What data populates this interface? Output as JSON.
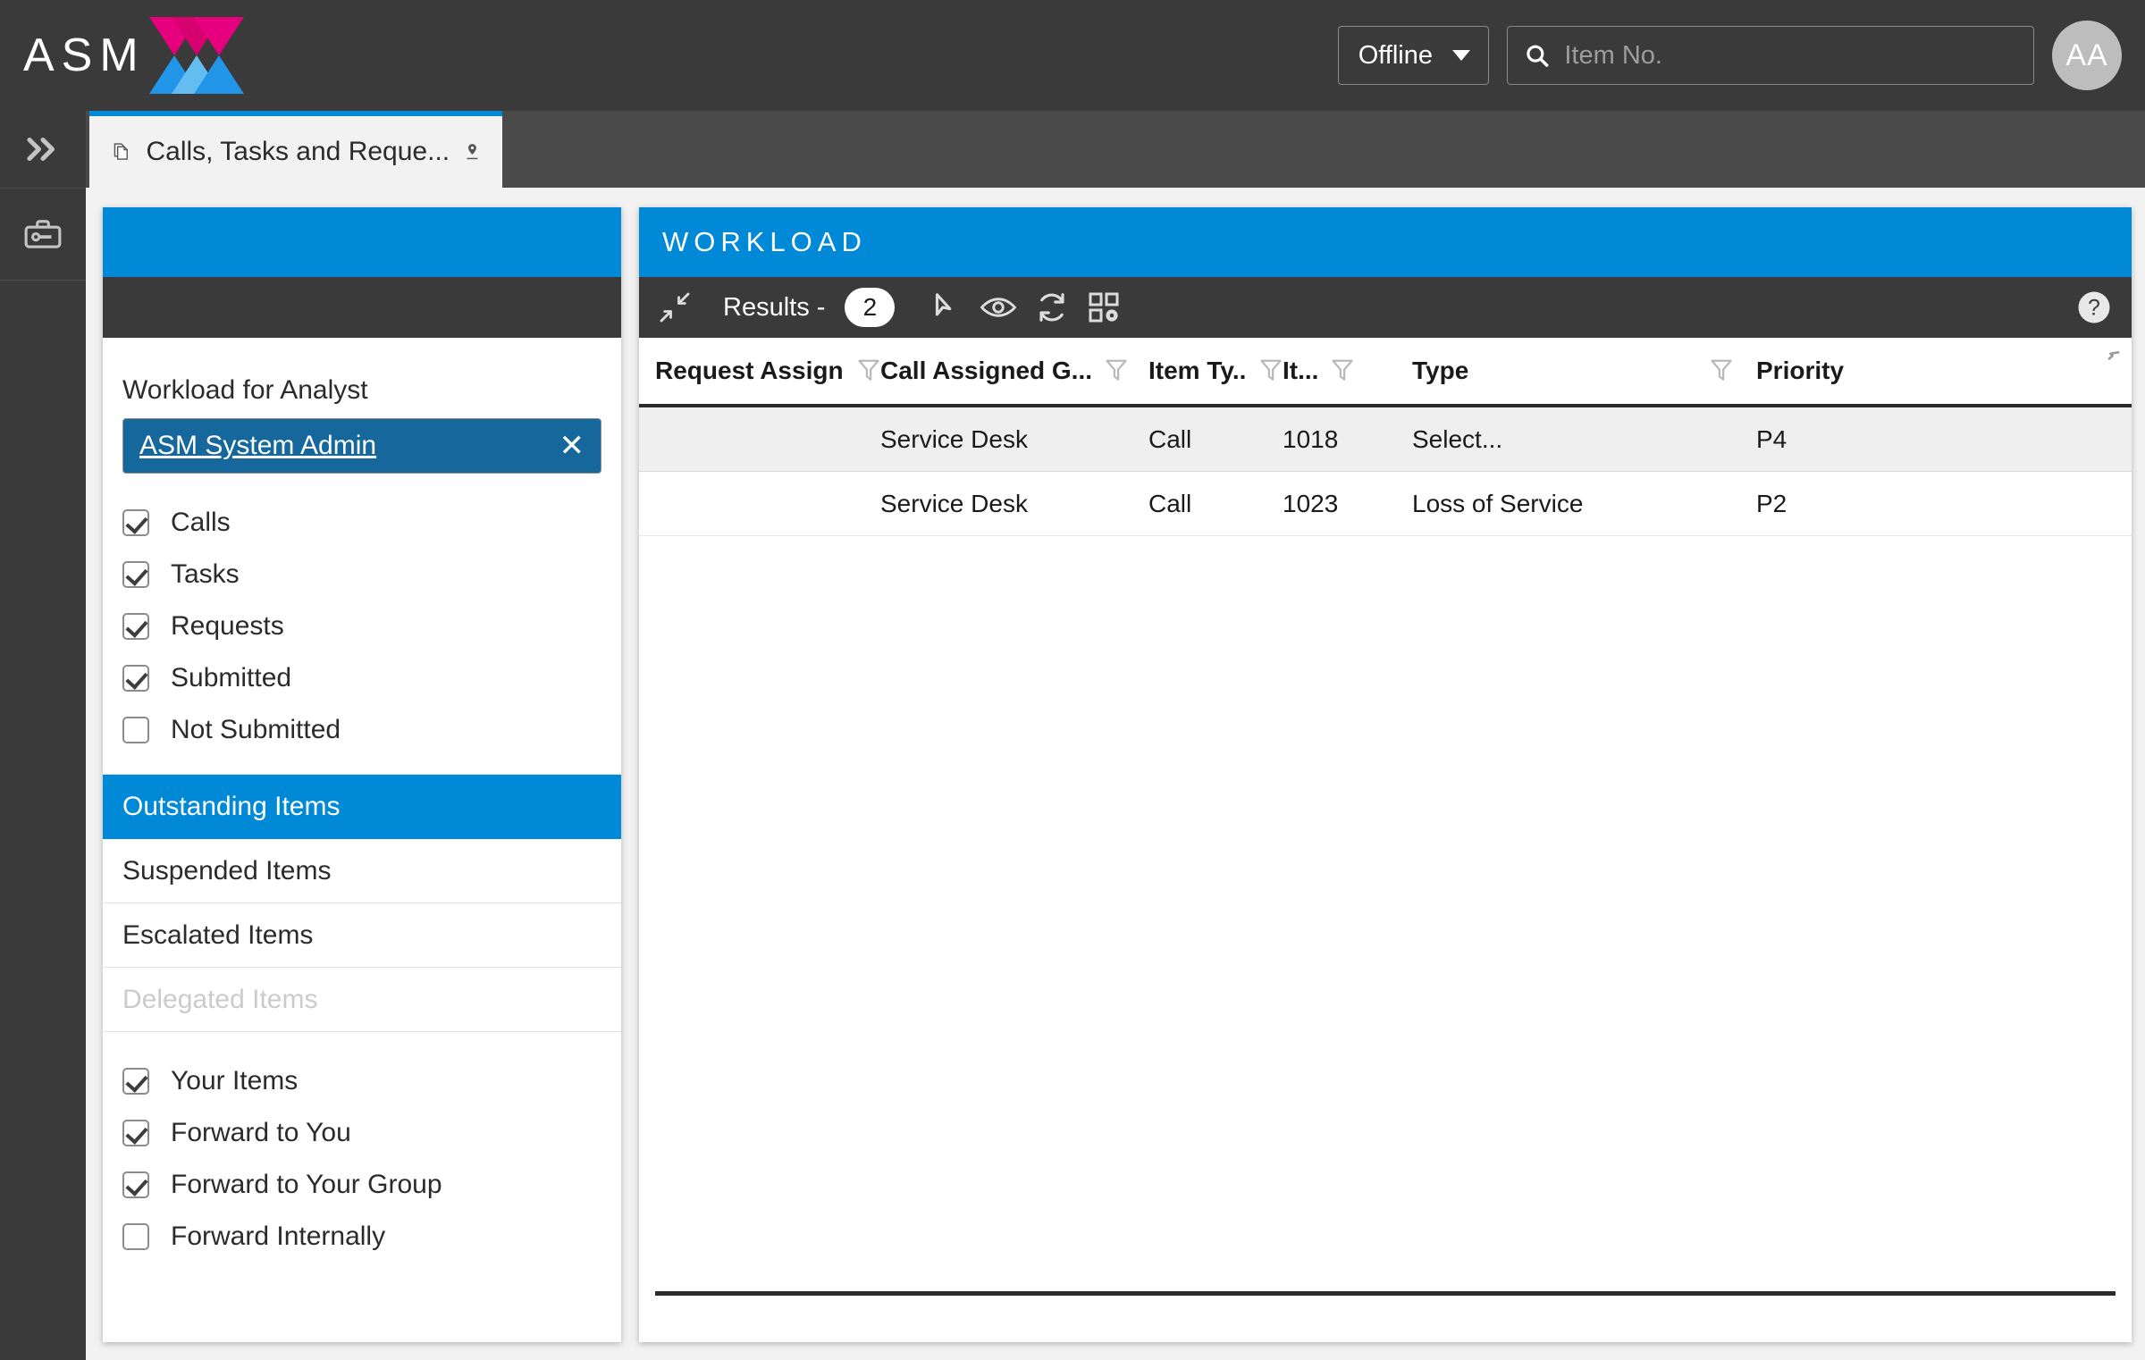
{
  "header": {
    "logo_text": "ASM",
    "logo_icon": "asm-x-logo",
    "status_select": {
      "value": "Offline",
      "icon": "chevron-down-icon"
    },
    "search": {
      "placeholder": "Item No.",
      "value": "",
      "icon": "search-icon"
    },
    "avatar_initials": "AA",
    "colors": {
      "bar_bg": "#3a3a3a",
      "logo_pink": "#e6007e",
      "logo_blue": "#2196e8"
    }
  },
  "tabs": [
    {
      "label": "Calls, Tasks and Reque...",
      "icon": "copy-pages-icon",
      "pin_icon": "pin-location-icon",
      "active": true
    }
  ],
  "rail": {
    "items": [
      {
        "name": "expand-panel",
        "icon": "double-chevron-right-icon"
      },
      {
        "name": "toolbox",
        "icon": "toolbox-wrench-icon"
      }
    ]
  },
  "left_panel": {
    "field_label": "Workload for Analyst",
    "analyst": {
      "value": "ASM System Admin",
      "clear_icon": "close-icon"
    },
    "type_filters": [
      {
        "label": "Calls",
        "checked": true
      },
      {
        "label": "Tasks",
        "checked": true
      },
      {
        "label": "Requests",
        "checked": true
      },
      {
        "label": "Submitted",
        "checked": true
      },
      {
        "label": "Not Submitted",
        "checked": false
      }
    ],
    "nav_items": [
      {
        "label": "Outstanding Items",
        "selected": true,
        "disabled": false
      },
      {
        "label": "Suspended Items",
        "selected": false,
        "disabled": false
      },
      {
        "label": "Escalated Items",
        "selected": false,
        "disabled": false
      },
      {
        "label": "Delegated Items",
        "selected": false,
        "disabled": true
      }
    ],
    "scope_filters": [
      {
        "label": "Your Items",
        "checked": true
      },
      {
        "label": "Forward to You",
        "checked": true
      },
      {
        "label": "Forward to Your Group",
        "checked": true
      },
      {
        "label": "Forward Internally",
        "checked": false
      }
    ],
    "colors": {
      "header_blue": "#0089d6",
      "toolbar_dark": "#3a3a3a",
      "pill_blue": "#15679c"
    }
  },
  "right_panel": {
    "title": "WORKLOAD",
    "toolbar": {
      "collapse_icon": "collapse-arrows-icon",
      "results_label": "Results -",
      "results_count": "2",
      "icons": [
        {
          "name": "pointer-cursor-icon"
        },
        {
          "name": "eye-preview-icon"
        },
        {
          "name": "refresh-icon"
        },
        {
          "name": "grid-settings-icon"
        }
      ],
      "help_icon": "help-question-icon"
    },
    "table": {
      "columns": [
        {
          "label": "Request Assign...",
          "filter_icon": "funnel-filter-icon"
        },
        {
          "label": "Call Assigned G...",
          "filter_icon": "funnel-filter-icon"
        },
        {
          "label": "Item Ty...",
          "filter_icon": "funnel-filter-icon"
        },
        {
          "label": "It...",
          "filter_icon": "funnel-filter-icon"
        },
        {
          "label": "Type",
          "filter_icon": "funnel-filter-icon"
        },
        {
          "label": "Priority",
          "filter_icon": "funnel-filter-icon"
        }
      ],
      "corner_icon": "collapse-corner-icon",
      "rows": [
        {
          "request_assigned": "",
          "call_assigned_group": "Service Desk",
          "item_type": "Call",
          "item_no": "1018",
          "type": "Select...",
          "priority": "P4",
          "highlighted": true
        },
        {
          "request_assigned": "",
          "call_assigned_group": "Service Desk",
          "item_type": "Call",
          "item_no": "1023",
          "type": "Loss of Service",
          "priority": "P2",
          "highlighted": false
        }
      ]
    }
  }
}
